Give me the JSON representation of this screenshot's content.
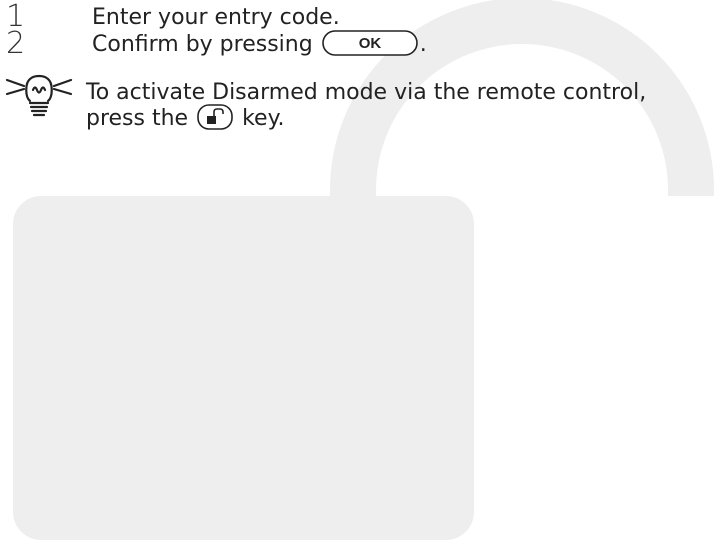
{
  "steps": [
    {
      "number": "1",
      "text": "Enter your entry code."
    },
    {
      "number": "2",
      "text_before": "Confirm by pressing",
      "key_label": "OK",
      "text_after": "."
    }
  ],
  "tip": {
    "line1": "To activate Disarmed mode via the remote control,",
    "line2_before": "press the",
    "line2_after": "key.",
    "key_icon": "unlock-icon",
    "icon": "lightbulb-tip-icon"
  },
  "colors": {
    "text": "#222222",
    "lock_fill": "#eeeeee"
  }
}
